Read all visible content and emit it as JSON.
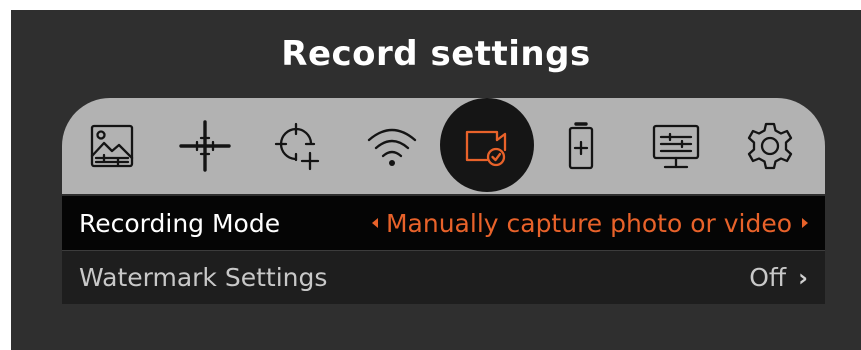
{
  "header": {
    "title": "Record settings"
  },
  "tabs": [
    {
      "icon": "image-settings-icon",
      "active": false
    },
    {
      "icon": "reticle-icon",
      "active": false
    },
    {
      "icon": "zeroing-crosshair-icon",
      "active": false
    },
    {
      "icon": "wifi-icon",
      "active": false
    },
    {
      "icon": "record-camera-icon",
      "active": true
    },
    {
      "icon": "battery-icon",
      "active": false
    },
    {
      "icon": "display-settings-icon",
      "active": false
    },
    {
      "icon": "gear-icon",
      "active": false
    }
  ],
  "settings": [
    {
      "label": "Recording Mode",
      "value": "Manually capture photo or video",
      "selected": true
    },
    {
      "label": "Watermark Settings",
      "value": "Off",
      "selected": false
    }
  ],
  "colors": {
    "accent": "#e8622a",
    "panel": "#2f2f2f",
    "tabbar": "#b2b2b2"
  }
}
